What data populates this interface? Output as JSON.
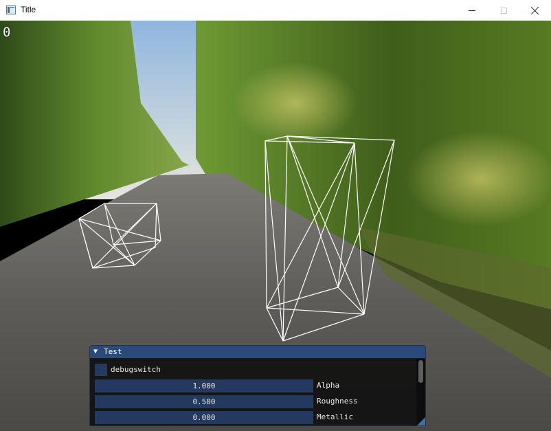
{
  "window": {
    "title": "Title"
  },
  "overlay": {
    "counter": "0"
  },
  "scene": {
    "background": "park avenue hdr environment with two wireframe meshes"
  },
  "imgui": {
    "panel_title": "Test",
    "checkbox_label": "debugswitch",
    "checkbox_checked": false,
    "sliders": [
      {
        "value": "1.000",
        "label": "Alpha"
      },
      {
        "value": "0.500",
        "label": "Roughness"
      },
      {
        "value": "0.000",
        "label": "Metallic"
      }
    ]
  },
  "colors": {
    "imgui_title": "#294a7a",
    "imgui_frame": "#24395e",
    "imgui_bg": "#121212",
    "wireframe": "#ffffff"
  }
}
